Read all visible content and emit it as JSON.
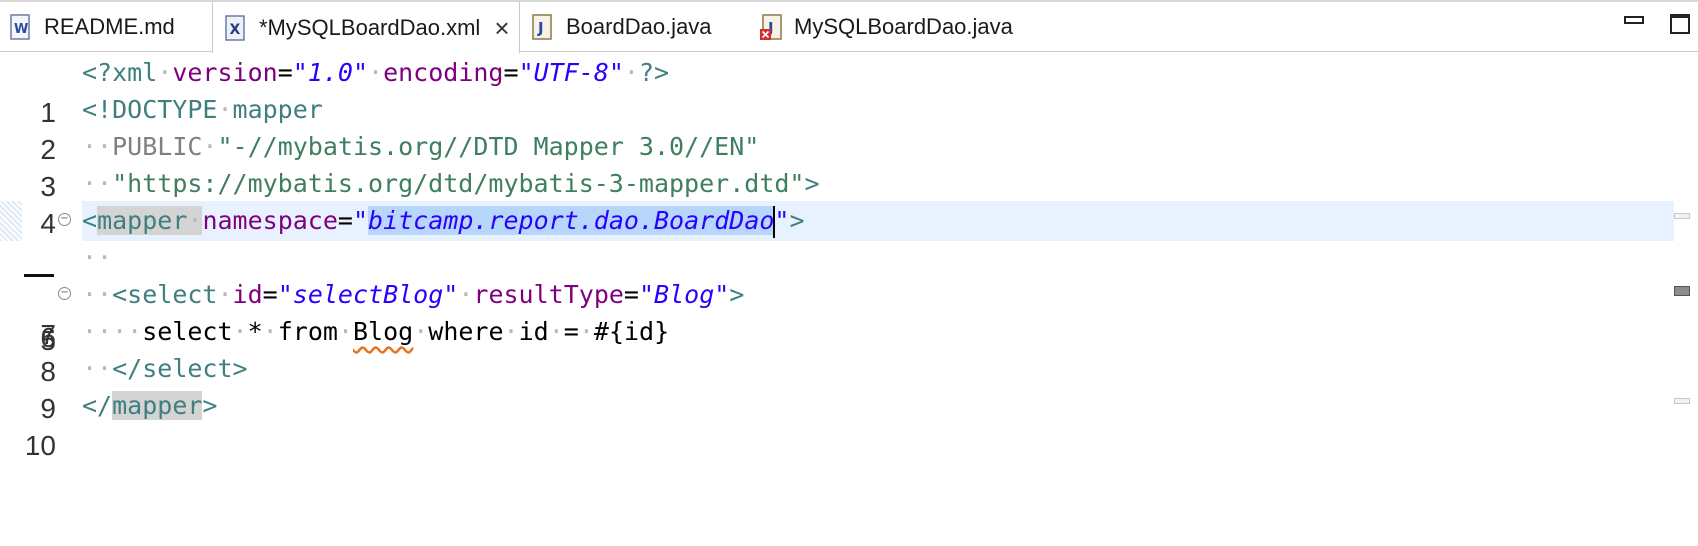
{
  "tabs": [
    {
      "label": "README.md",
      "icon": "markdown-file-icon",
      "active": false
    },
    {
      "label": "*MySQLBoardDao.xml",
      "icon": "xml-file-icon",
      "active": true
    },
    {
      "label": "BoardDao.java",
      "icon": "java-file-icon",
      "active": false
    },
    {
      "label": "MySQLBoardDao.java",
      "icon": "java-file-error-icon",
      "active": false
    }
  ],
  "close_label": "×",
  "colors": {
    "tag": "#3f7f7f",
    "attribute": "#7f007f",
    "value": "#2a00ff",
    "string": "#3f7f5f",
    "current_line": "#e8f2fe",
    "selection": "#b6d6fb"
  },
  "editor": {
    "line_numbers": [
      "1",
      "2",
      "3",
      "4",
      "5",
      "6",
      "7",
      "8",
      "9",
      "10"
    ],
    "current_line": "5",
    "lines": {
      "l1": {
        "open": "<?xml",
        "a1": "version",
        "eq1": "=",
        "v1": "\"1.0\"",
        "a2": "encoding",
        "eq2": "=",
        "v2": "\"UTF-8\"",
        "close": "?>"
      },
      "l2": {
        "open": "<!DOCTYPE",
        "name": "mapper"
      },
      "l3": {
        "kw": "PUBLIC",
        "str": "\"-//mybatis.org//DTD Mapper 3.0//EN\""
      },
      "l4": {
        "str": "\"https://mybatis.org/dtd/mybatis-3-mapper.dtd\"",
        "close": ">"
      },
      "l5": {
        "lt": "<",
        "tag": "mapper",
        "attr": "namespace",
        "eq": "=",
        "q1": "\"",
        "sel": "bitcamp.report.dao.BoardDao",
        "q2": "\"",
        "close": ">"
      },
      "l7": {
        "lt": "<",
        "tag": "select",
        "a1": "id",
        "eq1": "=",
        "v1": "\"selectBlog\"",
        "a2": "resultType",
        "eq2": "=",
        "v2": "\"Blog\"",
        "close": ">"
      },
      "l8": {
        "t1": "select",
        "t2": "*",
        "t3": "from",
        "t4": "Blog",
        "t5": "where",
        "t6": "id",
        "t7": "=",
        "t8": "#{id}"
      },
      "l9": {
        "open": "</",
        "tag": "select",
        "close": ">"
      },
      "l10": {
        "open": "</",
        "tag": "mapper",
        "close": ">"
      }
    }
  }
}
